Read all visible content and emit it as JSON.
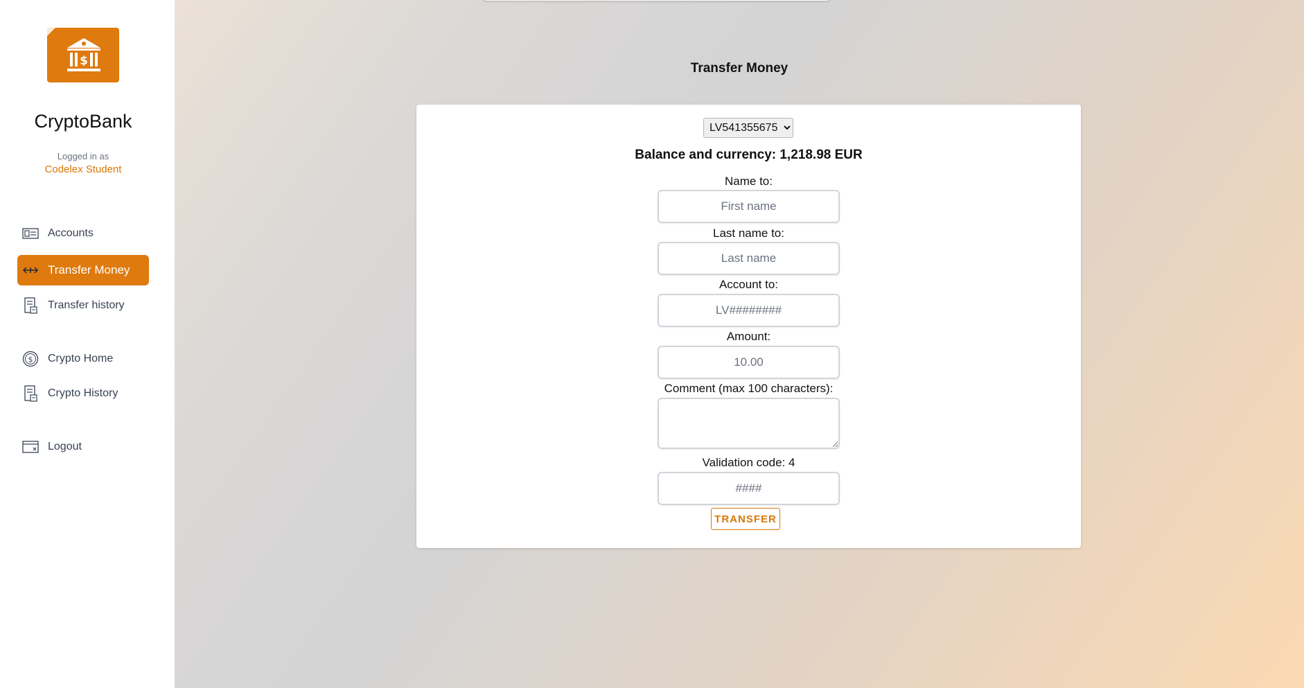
{
  "app": {
    "name": "CryptoBank"
  },
  "user": {
    "logged_label": "Logged in as",
    "name": "Codelex Student"
  },
  "sidebar": {
    "items": [
      {
        "label": "Accounts",
        "icon": "accounts-card-icon"
      },
      {
        "label": "Transfer Money",
        "icon": "transfer-arrows-icon",
        "active": true
      },
      {
        "label": "Transfer history",
        "icon": "receipt-icon"
      },
      {
        "label": "Crypto Home",
        "icon": "coin-icon"
      },
      {
        "label": "Crypto History",
        "icon": "receipt-icon"
      },
      {
        "label": "Logout",
        "icon": "logout-window-icon"
      }
    ]
  },
  "page": {
    "title": "Transfer Money"
  },
  "form": {
    "account_selected": "LV541355675",
    "balance_text": "Balance and currency: 1,218.98 EUR",
    "name_label": "Name to:",
    "name_placeholder": "First name",
    "lastname_label": "Last name to:",
    "lastname_placeholder": "Last name",
    "account_label": "Account to:",
    "account_placeholder": "LV########",
    "amount_label": "Amount:",
    "amount_placeholder": "10.00",
    "comment_label": "Comment (max 100 characters):",
    "comment_value": "",
    "validation_label": "Validation code: 4",
    "validation_placeholder": "####",
    "submit_label": "TRANSFER"
  },
  "colors": {
    "accent": "#de7a0e",
    "accent_text": "#d97706",
    "sidebar_bg": "#ffffff"
  }
}
